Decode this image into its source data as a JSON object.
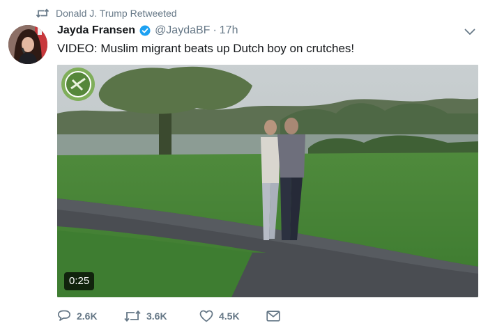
{
  "retweet_context": {
    "text": "Donald J. Trump Retweeted",
    "icon": "retweet-icon"
  },
  "tweet": {
    "author": {
      "name": "Jayda Fransen",
      "handle": "@JaydaBF",
      "verified": true,
      "avatar": "profile-photo"
    },
    "separator": "·",
    "timestamp": "17h",
    "text": "VIDEO: Muslim migrant beats up Dutch boy on crutches!",
    "media": {
      "type": "video",
      "duration": "0:25"
    },
    "actions": {
      "replies": "2.6K",
      "retweets": "3.6K",
      "likes": "4.5K"
    }
  },
  "colors": {
    "text_primary": "#14171a",
    "text_secondary": "#657786",
    "verified": "#1da1f2",
    "badge_bg": "#000000"
  }
}
